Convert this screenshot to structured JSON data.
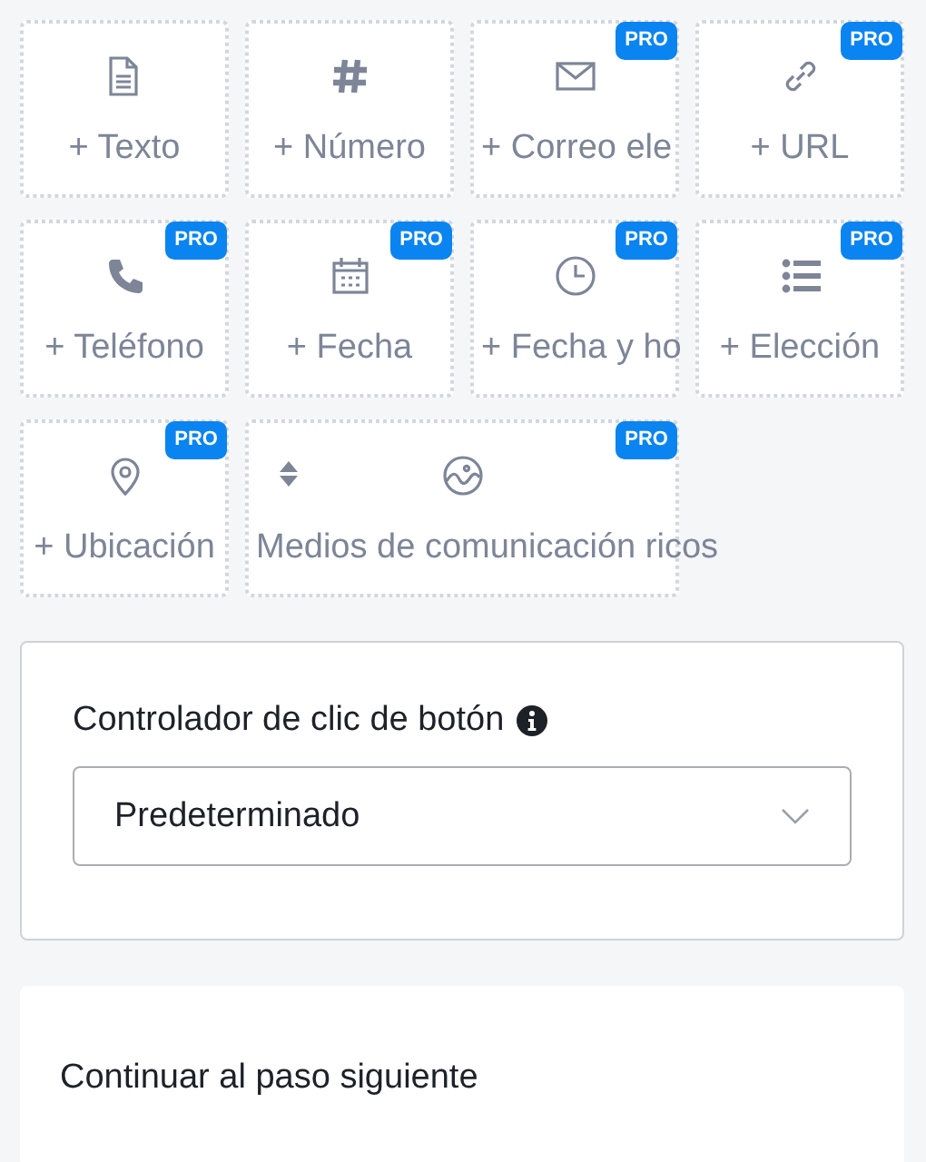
{
  "fields": [
    {
      "kind": "field",
      "label": "+ Texto"
    },
    {
      "kind": "field",
      "label": "+ Número"
    },
    {
      "kind": "field",
      "label": "+ Correo ele",
      "badge": "PRO"
    },
    {
      "kind": "field",
      "label": "+ URL",
      "badge": "PRO"
    },
    {
      "kind": "field",
      "label": "+ Teléfono",
      "badge": "PRO"
    },
    {
      "kind": "field",
      "label": "+ Fecha",
      "badge": "PRO"
    },
    {
      "kind": "field",
      "label": "+ Fecha y ho",
      "badge": "PRO"
    },
    {
      "kind": "field",
      "label": "+ Elección",
      "badge": "PRO"
    },
    {
      "kind": "field",
      "label": "+ Ubicación",
      "badge": "PRO"
    },
    {
      "kind": "media",
      "label": "Medios de comunicación ricos",
      "badge": "PRO"
    }
  ],
  "click_handler": {
    "label": "Controlador de clic de botón",
    "value": "Predeterminado"
  },
  "next_step": {
    "label": "Continuar al paso siguiente"
  }
}
